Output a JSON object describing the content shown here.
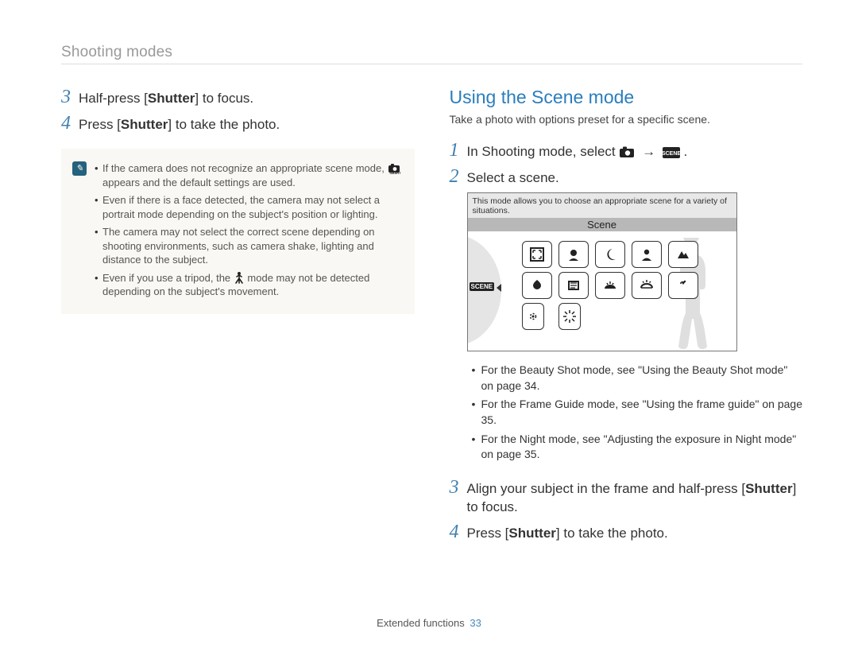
{
  "header": "Shooting modes",
  "left": {
    "steps": [
      {
        "num": "3",
        "pre": "Half-press [",
        "bold": "Shutter",
        "post": "] to focus."
      },
      {
        "num": "4",
        "pre": "Press [",
        "bold": "Shutter",
        "post": "] to take the photo."
      }
    ],
    "note_items": [
      {
        "text_pre": "If the camera does not recognize an appropriate scene mode, ",
        "icon": "smart-auto",
        "text_post": " appears and the default settings are used."
      },
      {
        "text_pre": "Even if there is a face detected, the camera may not select a portrait mode depending on the subject's position or lighting.",
        "icon": null,
        "text_post": ""
      },
      {
        "text_pre": "The camera may not select the correct scene depending on shooting environments, such as camera shake, lighting and distance to the subject.",
        "icon": null,
        "text_post": ""
      },
      {
        "text_pre": "Even if you use a tripod, the ",
        "icon": "tripod-person",
        "text_post": " mode may not be detected depending on the subject's movement."
      }
    ]
  },
  "right": {
    "title": "Using the Scene mode",
    "subtitle": "Take a photo with options preset for a specific scene.",
    "steps_a": [
      {
        "num": "1",
        "pre": "In Shooting mode, select ",
        "icon1": "camera-icon",
        "arrow": "→",
        "icon2": "scene-badge",
        "post": " ."
      },
      {
        "num": "2",
        "pre": "Select a scene.",
        "icon1": null
      }
    ],
    "scene_tip": "This mode allows you to choose an appropriate scene for a variety of situations.",
    "scene_tab": "Scene",
    "scene_dial_label": "SCENE",
    "scene_icons": [
      "frame-guide",
      "beauty-shot",
      "night",
      "portrait",
      "children",
      "landscape",
      "close-up",
      "text",
      "sunset",
      "dawn",
      "backlight",
      "fireworks"
    ],
    "bullets": [
      "For the Beauty Shot mode, see \"Using the Beauty Shot mode\" on page 34.",
      "For the Frame Guide mode, see \"Using the frame guide\" on page 35.",
      "For the Night mode, see \"Adjusting the exposure in Night mode\" on page 35."
    ],
    "steps_b": [
      {
        "num": "3",
        "pre": "Align your subject in the frame and half-press [",
        "bold": "Shutter",
        "post": "] to focus."
      },
      {
        "num": "4",
        "pre": "Press [",
        "bold": "Shutter",
        "post": "] to take the photo."
      }
    ]
  },
  "footer": {
    "label": "Extended functions",
    "page": "33"
  }
}
